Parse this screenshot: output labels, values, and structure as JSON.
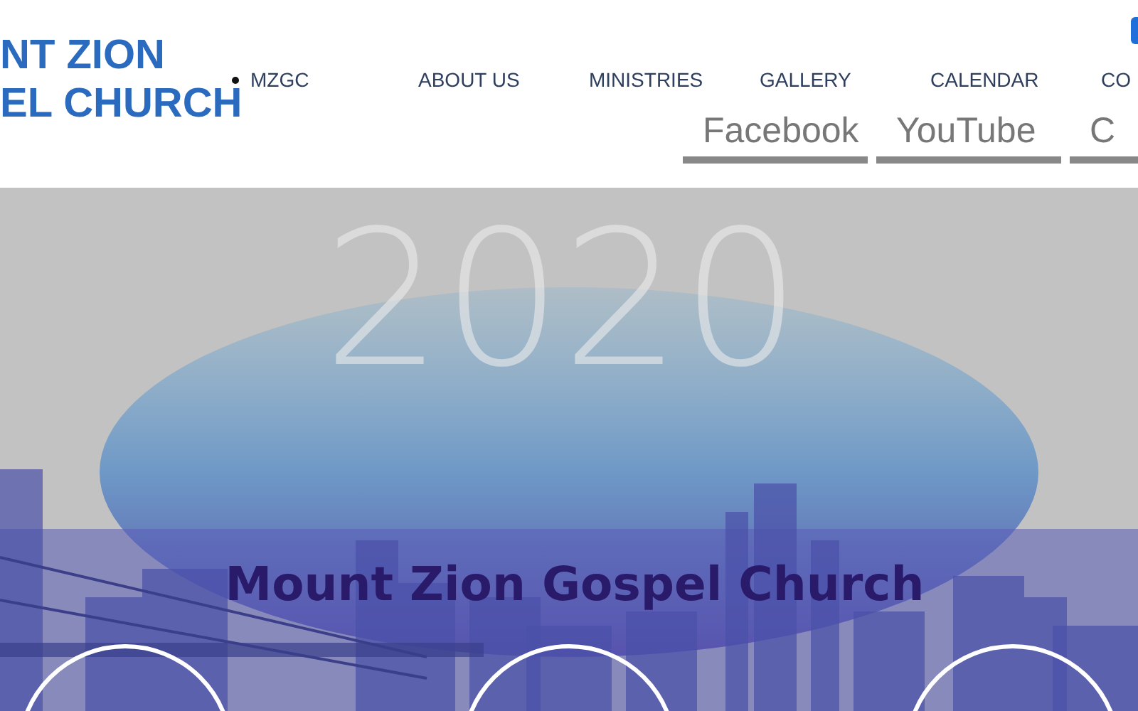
{
  "header": {
    "logo_lines": [
      "NT ZION",
      "EL CHURCH"
    ],
    "nav": [
      {
        "label": "MZGC",
        "kind": "bulleted"
      },
      {
        "label": "ABOUT US",
        "kind": "plain"
      },
      {
        "label": "MINISTRIES",
        "kind": "plain"
      },
      {
        "label": "GALLERY",
        "kind": "plain"
      },
      {
        "label": "CALENDAR",
        "kind": "plain"
      },
      {
        "label": "CO",
        "kind": "plain"
      }
    ],
    "social_buttons": [
      "Facebook",
      "YouTube",
      "C"
    ]
  },
  "hero": {
    "year": "2020",
    "title": "Mount Zion Gospel Church"
  }
}
